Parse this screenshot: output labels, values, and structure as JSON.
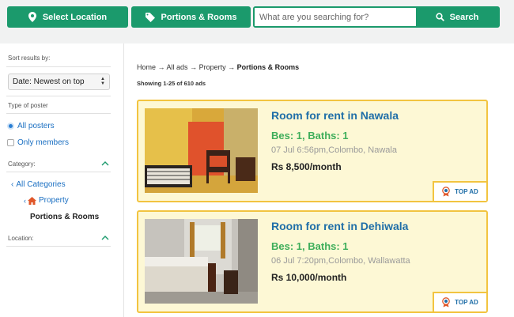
{
  "topbar": {
    "select_location": "Select Location",
    "portions_rooms": "Portions & Rooms",
    "search_placeholder": "What are you searching for?",
    "search_button": "Search"
  },
  "sidebar": {
    "sort_label": "Sort results by:",
    "sort_value": "Date: Newest on top",
    "poster_label": "Type of poster",
    "poster_options": [
      "All posters",
      "Only members"
    ],
    "category_label": "Category:",
    "all_categories": "All Categories",
    "property": "Property",
    "portions_rooms": "Portions & Rooms",
    "location_label": "Location:"
  },
  "main": {
    "breadcrumb": {
      "home": "Home",
      "all_ads": "All ads",
      "property": "Property",
      "current": "Portions & Rooms",
      "separator": "→"
    },
    "showing": "Showing 1-25 of 610 ads",
    "listings": [
      {
        "title": "Room for rent in Nawala",
        "specs": "Bes: 1, Baths: 1",
        "meta": "07 Jul 6:56pm,Colombo, Nawala",
        "price": "Rs 8,500/month",
        "badge": "TOP AD"
      },
      {
        "title": "Room for rent in Dehiwala",
        "specs": "Bes: 1, Baths: 1",
        "meta": "06 Jul 7:20pm,Colombo, Wallawatta",
        "price": "Rs 10,000/month",
        "badge": "TOP AD"
      }
    ]
  },
  "colors": {
    "brand_green": "#1b9a6c",
    "card_bg": "#fdf8d5",
    "card_border": "#f2c440",
    "title_blue": "#1f6ea8",
    "specs_green": "#3fae5b"
  }
}
